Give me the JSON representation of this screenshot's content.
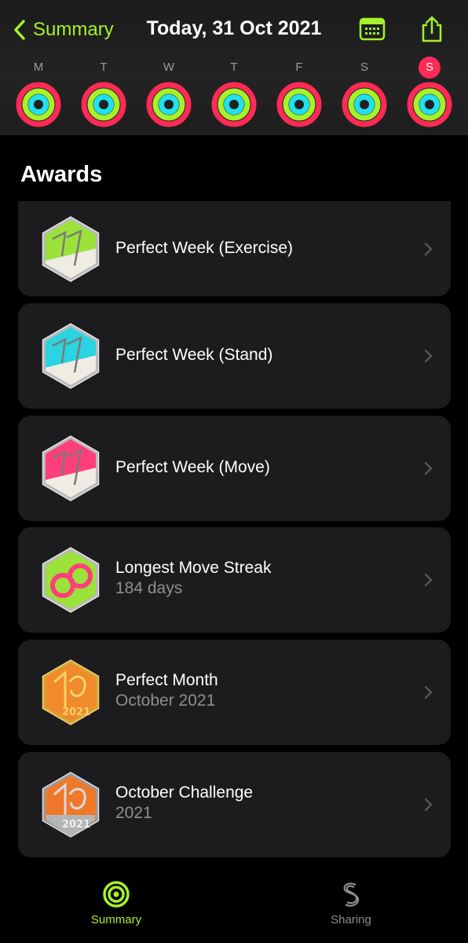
{
  "header": {
    "back_label": "Summary",
    "title": "Today, 31 Oct 2021",
    "calendar_icon": "calendar-icon",
    "share_icon": "share-icon",
    "accent": "#a6f12a"
  },
  "week": {
    "days": [
      "M",
      "T",
      "W",
      "T",
      "F",
      "S",
      "S"
    ],
    "today_index": 6,
    "ring_colors": {
      "move": "#ff2a55",
      "exercise": "#a6f12a",
      "stand": "#22e0f0"
    }
  },
  "awards": {
    "title": "Awards",
    "items": [
      {
        "name": "Perfect Week (Exercise)",
        "sub": "",
        "badge": "perfect-week-exercise-badge-icon"
      },
      {
        "name": "Perfect Week (Stand)",
        "sub": "",
        "badge": "perfect-week-stand-badge-icon"
      },
      {
        "name": "Perfect Week (Move)",
        "sub": "",
        "badge": "perfect-week-move-badge-icon"
      },
      {
        "name": "Longest Move Streak",
        "sub": "184 days",
        "badge": "longest-move-streak-badge-icon"
      },
      {
        "name": "Perfect Month",
        "sub": "October 2021",
        "badge": "perfect-month-badge-icon"
      },
      {
        "name": "October Challenge",
        "sub": "2021",
        "badge": "october-challenge-badge-icon"
      }
    ]
  },
  "tabbar": {
    "summary_label": "Summary",
    "sharing_label": "Sharing",
    "active": "summary"
  }
}
